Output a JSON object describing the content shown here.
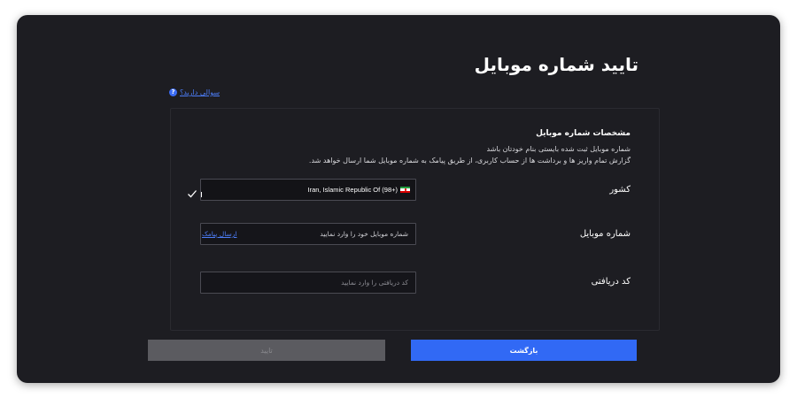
{
  "page": {
    "title": "تایید شماره موبایل",
    "help_link": "سوالی دارید؟",
    "help_icon_glyph": "?"
  },
  "panel": {
    "section_title": "مشخصات شماره موبایل",
    "desc_line1": "شماره موبایل ثبت شده بایستی بنام خودتان باشد",
    "desc_line2": "گزارش تمام واریز ها و برداشت ها از حساب کاربری، از طریق پیامک به شماره موبایل شما ارسال خواهد شد."
  },
  "fields": {
    "country": {
      "label": "کشور",
      "value": "Iran, Islamic Republic Of (98+)",
      "flag_icon": "iran-flag-icon",
      "verified_icon": "check-icon"
    },
    "mobile": {
      "label": "شماره موبایل",
      "placeholder": "شماره موبایل خود را وارد نمایید",
      "send_sms_label": "ارسال پیامک"
    },
    "code": {
      "label": "کد دریافتی",
      "placeholder": "کد دریافتی را وارد نمایید"
    }
  },
  "buttons": {
    "confirm_label": "تایید",
    "back_label": "بازگشت"
  },
  "colors": {
    "background": "#1d1d22",
    "accent": "#3169f5",
    "link": "#4c7df7",
    "disabled_button": "#5b5b60"
  }
}
